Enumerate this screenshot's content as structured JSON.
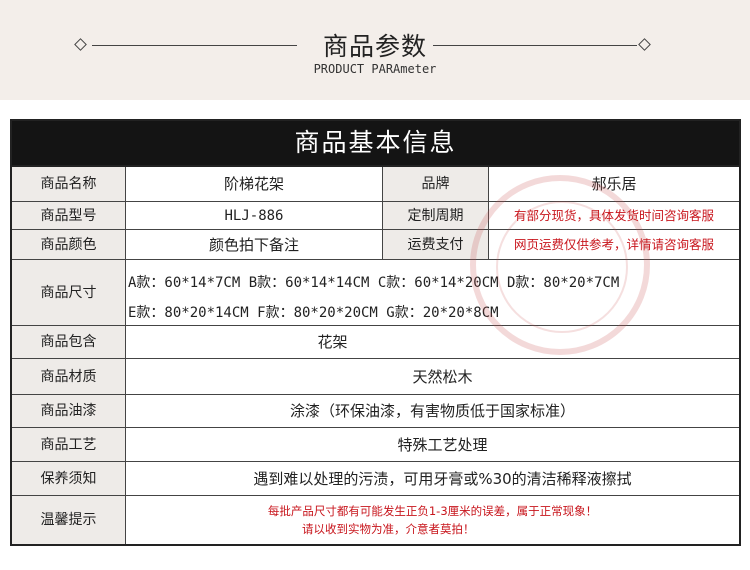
{
  "header": {
    "title": "商品参数",
    "subtitle": "PRODUCT PARAmeter"
  },
  "table": {
    "banner": "商品基本信息",
    "name_label": "商品名称",
    "name_value": "阶梯花架",
    "brand_label": "品牌",
    "brand_value": "郝乐居",
    "model_label": "商品型号",
    "model_value": "HLJ-886",
    "custom_label": "定制周期",
    "custom_value": "有部分现货，具体发货时间咨询客服",
    "color_label": "商品颜色",
    "color_value": "颜色拍下备注",
    "shipping_label": "运费支付",
    "shipping_value": "网页运费仅供参考，详情请咨询客服",
    "size_label": "商品尺寸",
    "size_line1": "A款：60*14*7CM  B款：60*14*14CM  C款：60*14*20CM  D款：80*20*7CM",
    "size_line2": "E款：80*20*14CM F款：80*20*20CM  G款：20*20*8CM",
    "package_label": "商品包含",
    "package_value": "花架",
    "material_label": "商品材质",
    "material_value": "天然松木",
    "paint_label": "商品油漆",
    "paint_value": "涂漆（环保油漆，有害物质低于国家标准）",
    "craft_label": "商品工艺",
    "craft_value": "特殊工艺处理",
    "care_label": "保养须知",
    "care_value": "遇到难以处理的污渍，可用牙膏或%30的清洁稀释液擦拭",
    "tips_label": "温馨提示",
    "tips_line1": "每批产品尺寸都有可能发生正负1-3厘米的误差，属于正常现象！",
    "tips_line2": "请以收到实物为准，介意者莫拍！"
  },
  "colors": {
    "accent_red": "#c8161d",
    "banner_bg": "#141414",
    "label_bg": "#eeebe8"
  }
}
